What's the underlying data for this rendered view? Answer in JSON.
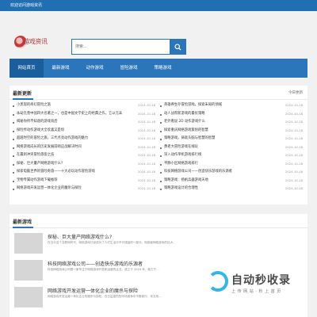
{
  "topbar": {
    "text": "欢迎访问游戏资讯"
  },
  "logo": {
    "text": "游戏资讯"
  },
  "search": {
    "placeholder": "搜索..."
  },
  "nav": {
    "items": [
      "网站首页",
      "最新游戏",
      "动作游戏",
      "冒险游戏",
      "策略游戏"
    ],
    "active_index": 0
  },
  "latest": {
    "title": "最新更新",
    "today_label": "今日更新",
    "left": [
      {
        "title": "小黑现的奇幻冒险之旅",
        "date": "2024-10-18"
      },
      {
        "title": "永劫无羡中国四大名著之一，也是中国文学史上的经典之作。它以元末",
        "date": "2024-10-18"
      },
      {
        "title": "揭秘你所不知道的游戏背后",
        "date": "2024-10-18"
      },
      {
        "title": "探险传动作游戏大全欢喜又是惊",
        "date": "2024-10-18"
      },
      {
        "title": "超越时空的冒险之旅，三代点亮动作游戏的魅力",
        "date": "2024-10-18"
      },
      {
        "title": "网络游戏成长的历史发展前哨应战解决时间",
        "date": "2024-10-18"
      },
      {
        "title": "在最刺冲突冒险旅客之技",
        "date": "2024-10-18"
      },
      {
        "title": "探秘、巨大量产网络游戏什么?",
        "date": "2024-10-18"
      },
      {
        "title": "探索电脑世界的冒险奇旅——十大必玩动作冒险游戏",
        "date": "2024-10-18"
      },
      {
        "title": "宝物专属动作游戏下载推荐",
        "date": "2024-10-18"
      },
      {
        "title": "网络游戏开发运营一体化企业的魔杀与探险",
        "date": "2024-10-18"
      }
    ],
    "right": [
      {
        "title": "英雄养生存冒险游戏，探索未知的领域",
        "date": "2024-10-18"
      },
      {
        "title": "动人战帮新游戏的最优策略",
        "date": "2024-10-18"
      },
      {
        "title": "老外看说 2D 动作游戏什么",
        "date": "2024-10-18"
      },
      {
        "title": "探索重庆网络游戏策划的智慧",
        "date": "2024-10-18"
      },
      {
        "title": "策略游戏，铸就头脑与智慧的智慧",
        "date": "2024-10-18"
      },
      {
        "title": "勇者大冒险游戏在线玩",
        "date": "2024-10-18"
      },
      {
        "title": "深入动作单机游戏排行榜",
        "date": "2024-10-18"
      },
      {
        "title": "平静小区网络游戏排行",
        "date": "2024-10-18"
      },
      {
        "title": "科技网络游戏公司——创造快乐游戏的乐源者",
        "date": "2024-10-18"
      },
      {
        "title": "策略游戏：扬帆兵器游戏天地",
        "date": "2024-10-18"
      },
      {
        "title": "策略游戏设计的合理性",
        "date": "2024-10-18"
      }
    ]
  },
  "games": {
    "title": "最新游戏",
    "items": [
      {
        "title": "探秘、巨大量产网络游戏什么?",
        "desc": "在当今这个互联网时代，网络游戏已经成为了人们生活中不可或缺的一部分。而探秘网络游戏的巨大..."
      },
      {
        "title": "科技网络游戏公司——创造快乐游戏的乐源者",
        "desc": "科技网络游戏公司是一家专注于网络游戏开发和运营的企业，成立于 2018 年，致力于..."
      },
      {
        "title": "网络游戏开发运营一体化企业的魔杀与探险",
        "desc": "网络游戏开发运营一体化企业的魔杀与探险，在日益激烈的市场竞争中不断前行，本文将..."
      }
    ]
  },
  "watermark": {
    "title": "自动秒收录",
    "subtitle": "上 传 网 站 · 秒 上 首 页"
  },
  "colors": {
    "primary": "#2b76bb",
    "topbar": "#1f6fb2",
    "background": "#f1f1f1"
  }
}
